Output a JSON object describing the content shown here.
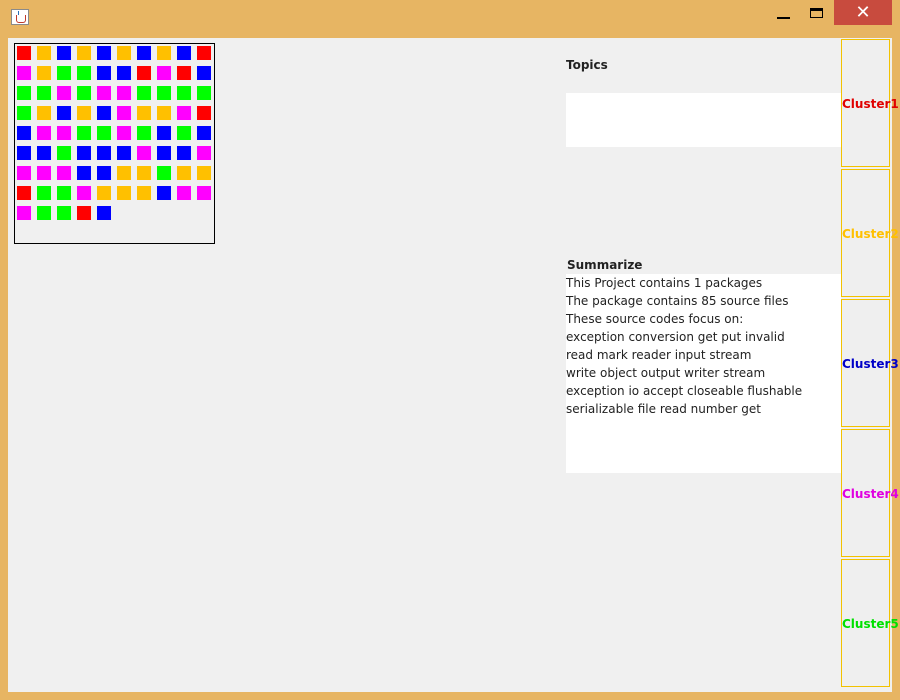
{
  "window": {
    "app_icon": "java-cup-icon",
    "controls": {
      "minimize_icon": "minimize-icon",
      "maximize_icon": "maximize-icon",
      "close_icon": "close-icon",
      "close_glyph": "✕"
    }
  },
  "grid": {
    "colors": {
      "R": "#ff0000",
      "O": "#ffc000",
      "B": "#0000ff",
      "G": "#00ff00",
      "M": "#ff00ff"
    },
    "rows": [
      [
        "R",
        "O",
        "B",
        "O",
        "B",
        "O",
        "B",
        "O",
        "B",
        "R"
      ],
      [
        "M",
        "O",
        "G",
        "G",
        "B",
        "B",
        "R",
        "M",
        "R",
        "B"
      ],
      [
        "G",
        "G",
        "M",
        "G",
        "M",
        "M",
        "G",
        "G",
        "G",
        "G"
      ],
      [
        "G",
        "O",
        "B",
        "O",
        "B",
        "M",
        "O",
        "O",
        "M",
        "R"
      ],
      [
        "B",
        "M",
        "M",
        "G",
        "G",
        "M",
        "G",
        "B",
        "G",
        "B"
      ],
      [
        "B",
        "B",
        "G",
        "B",
        "B",
        "B",
        "M",
        "B",
        "B",
        "M"
      ],
      [
        "M",
        "M",
        "M",
        "B",
        "B",
        "O",
        "O",
        "G",
        "O",
        "O"
      ],
      [
        "R",
        "G",
        "G",
        "M",
        "O",
        "O",
        "O",
        "B",
        "M",
        "M"
      ],
      [
        "M",
        "G",
        "G",
        "R",
        "B"
      ]
    ]
  },
  "topics": {
    "label": "Topics",
    "content": ""
  },
  "summary": {
    "label": "Summarize",
    "lines": [
      "This Project contains 1 packages",
      "The package contains 85 source files",
      "These source codes focus on:",
      "exception  conversion  get  put  invalid",
      "read  mark  reader  input  stream",
      "write  object  output  writer  stream",
      "exception  io  accept  closeable  flushable",
      "serializable  file  read  number  get"
    ]
  },
  "clusters": [
    {
      "label": "Cluster1",
      "color": "#e00000"
    },
    {
      "label": "Cluster2",
      "color": "#ffc000"
    },
    {
      "label": "Cluster3",
      "color": "#0000c8"
    },
    {
      "label": "Cluster4",
      "color": "#e000e0"
    },
    {
      "label": "Cluster5",
      "color": "#00e000"
    }
  ]
}
